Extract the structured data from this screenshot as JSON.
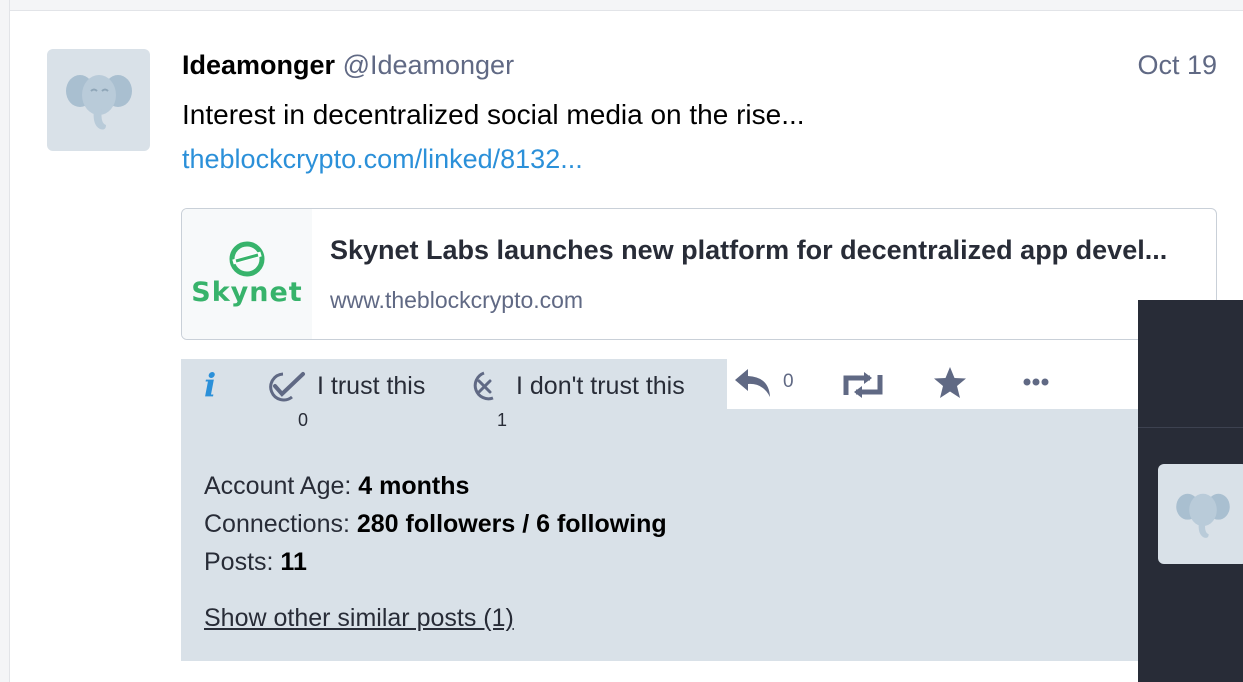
{
  "status": {
    "account": {
      "display_name": "Ideamonger",
      "handle": "@Ideamonger",
      "avatar_icon": "elephant-icon"
    },
    "date": "Oct 19",
    "content": "Interest in decentralized social media on the rise...",
    "link_text": "theblockcrypto.com/linked/8132...",
    "card": {
      "logo_text": "Skynet",
      "title": "Skynet Labs launches new platform for decentralized app devel...",
      "url": "www.theblockcrypto.com"
    },
    "trust": {
      "info_icon": "info-icon",
      "trust_label": "I trust this",
      "trust_count": "0",
      "distrust_label": "I don't trust this",
      "distrust_count": "1"
    },
    "actions": {
      "reply_count": "0",
      "icons": [
        "reply-icon",
        "boost-icon",
        "favourite-icon",
        "more-icon"
      ]
    },
    "stats": {
      "account_age_label": "Account Age: ",
      "account_age_value": "4 months",
      "connections_label": "Connections: ",
      "connections_value": "280 followers / 6 following",
      "posts_label": "Posts: ",
      "posts_value": "11"
    },
    "similar_link": "Show other similar posts (1)"
  },
  "colors": {
    "accent": "#2b90d9",
    "panel": "#d9e1e8",
    "dark": "#282c37",
    "skynet_green": "#37b36b"
  }
}
